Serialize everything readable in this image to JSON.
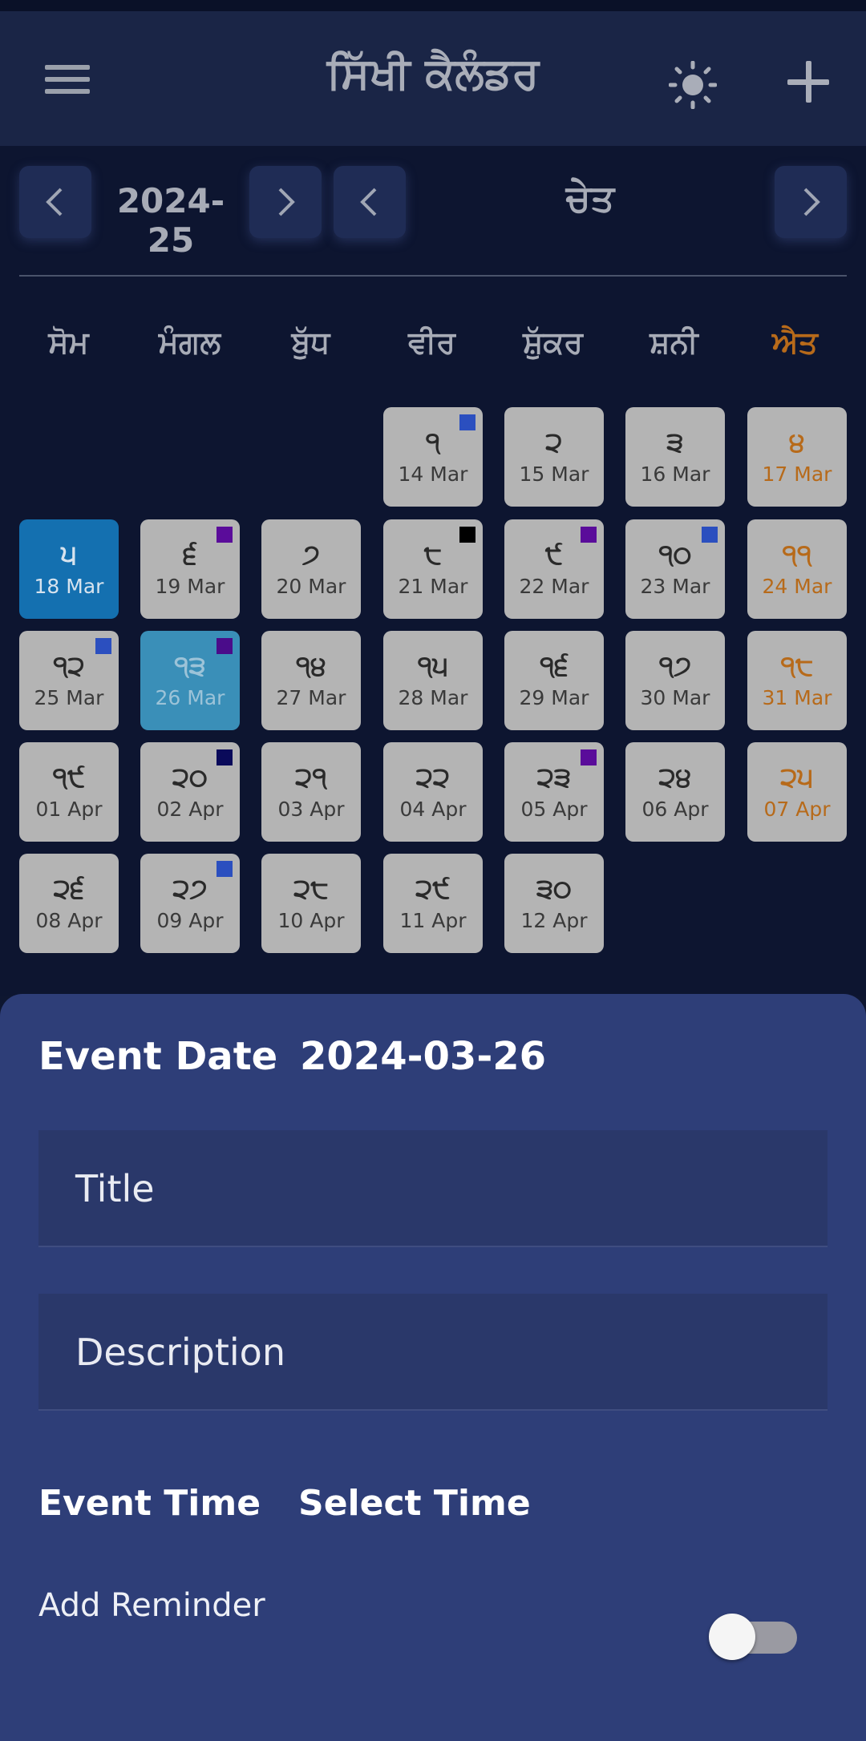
{
  "app": {
    "title": "ਸਿੱਖੀ ਕੈਲੰਡਰ",
    "icons": {
      "menu": "menu-icon",
      "theme": "sun-icon",
      "add": "plus-icon"
    }
  },
  "calendar": {
    "year": "2024-25",
    "month": "ਚੇਤ",
    "weekdays": [
      "ਸੋਮ",
      "ਮੰਗਲ",
      "ਬੁੱਧ",
      "ਵੀਰ",
      "ਸ਼ੁੱਕਰ",
      "ਸ਼ਨੀ",
      "ਐਤ"
    ],
    "days": [
      {
        "g": "੧",
        "d": "14 Mar",
        "mark": "#2b4fbf"
      },
      {
        "g": "੨",
        "d": "15 Mar"
      },
      {
        "g": "੩",
        "d": "16 Mar"
      },
      {
        "g": "੪",
        "d": "17 Mar"
      },
      {
        "g": "੫",
        "d": "18 Mar"
      },
      {
        "g": "੬",
        "d": "19 Mar",
        "mark": "#5a0c9a"
      },
      {
        "g": "੭",
        "d": "20 Mar"
      },
      {
        "g": "੮",
        "d": "21 Mar",
        "mark": "#000000"
      },
      {
        "g": "੯",
        "d": "22 Mar",
        "mark": "#5a0c9a"
      },
      {
        "g": "੧੦",
        "d": "23 Mar",
        "mark": "#2b4fbf"
      },
      {
        "g": "੧੧",
        "d": "24 Mar"
      },
      {
        "g": "੧੨",
        "d": "25 Mar",
        "mark": "#2b4fbf"
      },
      {
        "g": "੧੩",
        "d": "26 Mar",
        "mark": "#4a0c8a"
      },
      {
        "g": "੧੪",
        "d": "27 Mar"
      },
      {
        "g": "੧੫",
        "d": "28 Mar"
      },
      {
        "g": "੧੬",
        "d": "29 Mar"
      },
      {
        "g": "੧੭",
        "d": "30 Mar"
      },
      {
        "g": "੧੮",
        "d": "31 Mar"
      },
      {
        "g": "੧੯",
        "d": "01 Apr"
      },
      {
        "g": "੨੦",
        "d": "02 Apr",
        "mark": "#0a0a5a"
      },
      {
        "g": "੨੧",
        "d": "03 Apr"
      },
      {
        "g": "੨੨",
        "d": "04 Apr"
      },
      {
        "g": "੨੩",
        "d": "05 Apr",
        "mark": "#5a0c9a"
      },
      {
        "g": "੨੪",
        "d": "06 Apr"
      },
      {
        "g": "੨੫",
        "d": "07 Apr"
      },
      {
        "g": "੨੬",
        "d": "08 Apr"
      },
      {
        "g": "੨੭",
        "d": "09 Apr",
        "mark": "#2b4fbf"
      },
      {
        "g": "੨੮",
        "d": "10 Apr"
      },
      {
        "g": "੨੯",
        "d": "11 Apr"
      },
      {
        "g": "੩੦",
        "d": "12 Apr"
      }
    ]
  },
  "event_form": {
    "date_label": "Event Date",
    "date_value": "2024-03-26",
    "title_placeholder": "Title",
    "description_placeholder": "Description",
    "time_label": "Event Time",
    "time_value": "Select Time",
    "reminder_label": "Add Reminder",
    "reminder_on": false
  },
  "colors": {
    "sunday": "#b76a1a",
    "today": "#1470b0",
    "selected": "#3a8fb8",
    "sheet": "#2e3e78"
  }
}
